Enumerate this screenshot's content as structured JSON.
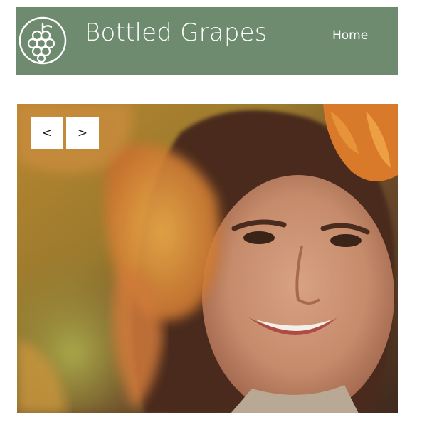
{
  "header": {
    "brand": "Bottled Grapes",
    "logo_icon": "grape-cluster-icon",
    "nav": {
      "home_label": "Home"
    }
  },
  "hero": {
    "image_label": "smiling woman among autumn vine leaves",
    "prev_label": "<",
    "next_label": ">",
    "icons": {
      "prev": "chevron-left-icon",
      "next": "chevron-right-icon"
    }
  },
  "colors": {
    "header_bg": "#6e8a6f",
    "header_text": "#ffffff",
    "button_bg": "#ffffff",
    "button_text": "#222222"
  }
}
